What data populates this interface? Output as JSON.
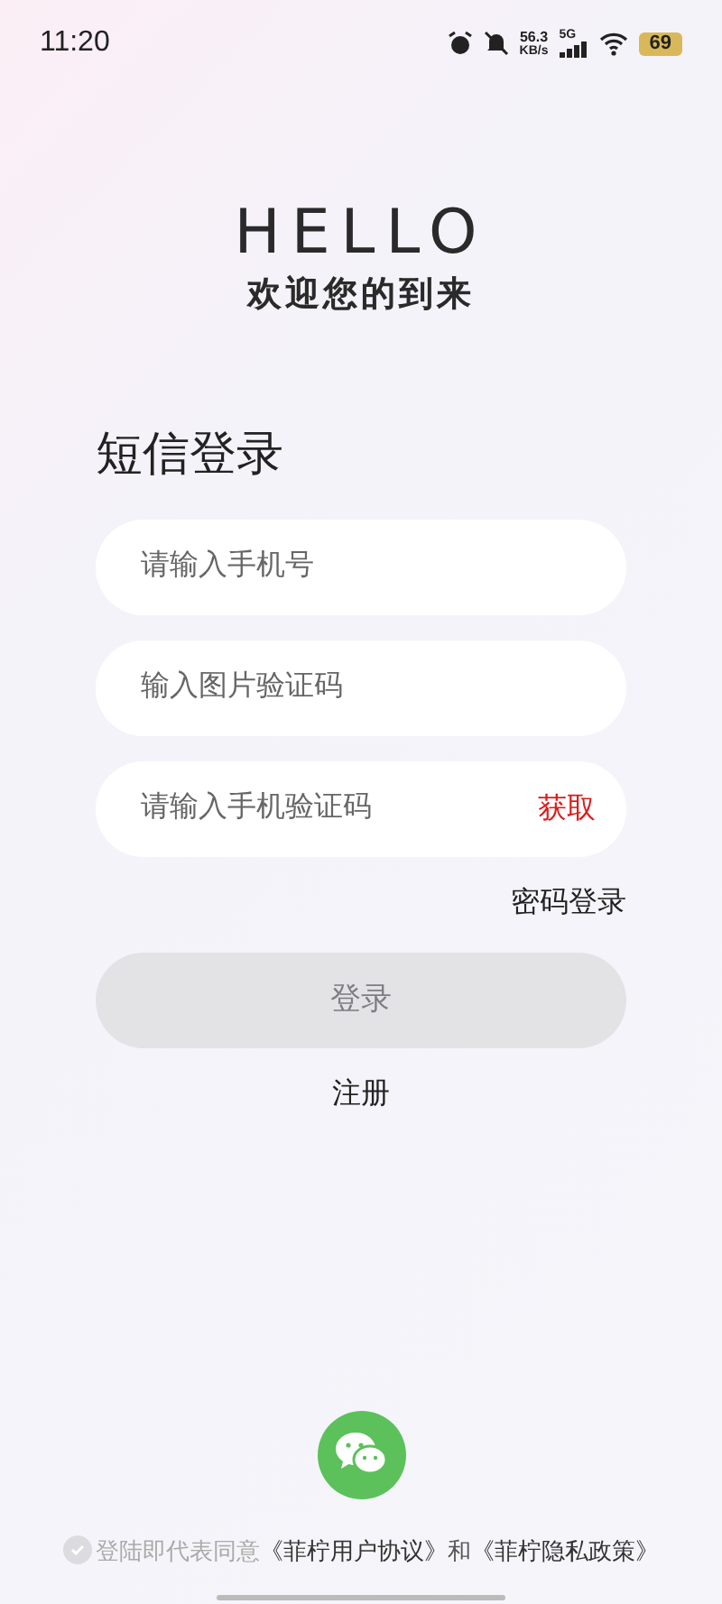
{
  "status_bar": {
    "time": "11:20",
    "net_speed": "56.3",
    "net_unit": "KB/s",
    "network": "5G",
    "battery": "69"
  },
  "header": {
    "title": "HELLO",
    "subtitle": "欢迎您的到来"
  },
  "form": {
    "title": "短信登录",
    "fields": [
      {
        "kind": "text",
        "placeholder": "请输入手机号"
      },
      {
        "kind": "text",
        "placeholder": "输入图片验证码"
      },
      {
        "kind": "code",
        "placeholder": "请输入手机验证码",
        "action": "获取"
      }
    ],
    "alt_login": "密码登录",
    "submit": {
      "label": "登录",
      "disabled": true
    },
    "register": "注册"
  },
  "agreement": {
    "checked": false,
    "text": "登陆即代表同意",
    "link1": "《菲柠用户协议》",
    "and": "和",
    "link2": "《菲柠隐私政策》"
  }
}
